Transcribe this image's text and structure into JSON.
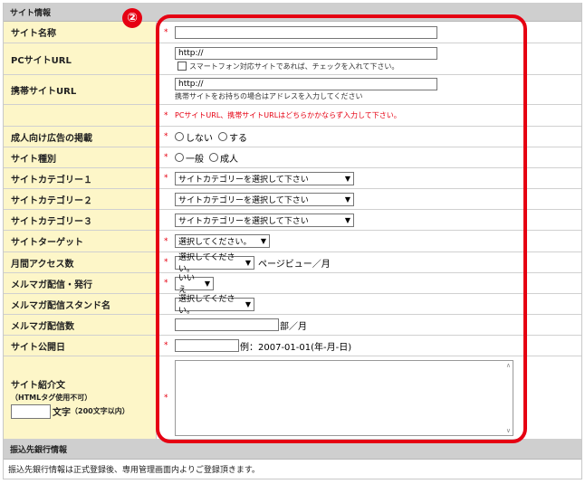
{
  "sections": {
    "site_info": "サイト情報",
    "bank_info": "振込先銀行情報"
  },
  "annotation": {
    "number": "②"
  },
  "required_mark": "*",
  "fields": {
    "site_name": {
      "label": "サイト名称",
      "value": ""
    },
    "pc_url": {
      "label": "PCサイトURL",
      "value": "http://",
      "checkbox_label": "スマートフォン対応サイトであれば、チェックを入れて下さい。"
    },
    "mobile_url": {
      "label": "携帯サイトURL",
      "value": "http://",
      "note": "携帯サイトをお持ちの場合はアドレスを入力してください"
    },
    "url_warning": "PCサイトURL、携帯サイトURLはどちらかかならず入力して下さい。",
    "adult_ads": {
      "label": "成人向け広告の掲載",
      "options": [
        "しない",
        "する"
      ]
    },
    "site_type": {
      "label": "サイト種別",
      "options": [
        "一般",
        "成人"
      ]
    },
    "category1": {
      "label": "サイトカテゴリー１",
      "selected": "サイトカテゴリーを選択して下さい"
    },
    "category2": {
      "label": "サイトカテゴリー２",
      "selected": "サイトカテゴリーを選択して下さい"
    },
    "category3": {
      "label": "サイトカテゴリー３",
      "selected": "サイトカテゴリーを選択して下さい"
    },
    "target": {
      "label": "サイトターゲット",
      "selected": "選択してください。"
    },
    "monthly_access": {
      "label": "月間アクセス数",
      "selected": "選択してください。",
      "suffix": "ページビュー／月"
    },
    "mailmag": {
      "label": "メルマガ配信・発行",
      "selected": "いいえ"
    },
    "mailmag_stand": {
      "label": "メルマガ配信スタンド名",
      "selected": "選択してください。"
    },
    "mailmag_count": {
      "label": "メルマガ配信数",
      "value": "",
      "suffix": "部／月"
    },
    "publish_date": {
      "label": "サイト公開日",
      "value": "",
      "example": "例：2007-01-01(年-月-日)"
    },
    "intro": {
      "label": "サイト紹介文",
      "sublabel": "（HTMLタグ使用不可）",
      "count_value": "",
      "count_suffix": "文字",
      "count_limit": "（200文字以内）",
      "value": ""
    }
  },
  "bank_note": "振込先銀行情報は正式登録後、専用管理画面内よりご登録頂きます。",
  "colors": {
    "label_bg": "#fdf6c8",
    "highlight": "#e60012",
    "header_bg": "#cfcfcf"
  }
}
